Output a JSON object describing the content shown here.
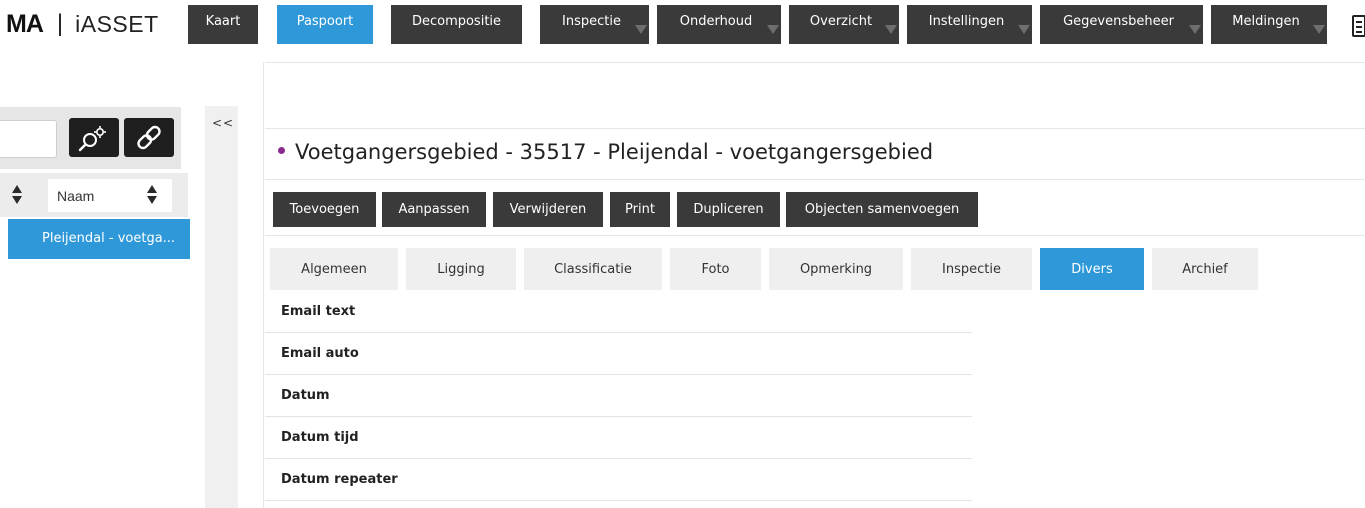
{
  "header": {
    "logo_mark": "MA",
    "logo_separator": "|",
    "app_name": "iASSET",
    "nav": [
      {
        "label": "Kaart",
        "has_dropdown": false,
        "active": false
      },
      {
        "label": "Paspoort",
        "has_dropdown": false,
        "active": true
      },
      {
        "label": "Decompositie",
        "has_dropdown": false,
        "active": false
      },
      {
        "label": "Inspectie",
        "has_dropdown": true,
        "active": false
      },
      {
        "label": "Onderhoud",
        "has_dropdown": true,
        "active": false
      },
      {
        "label": "Overzicht",
        "has_dropdown": true,
        "active": false
      },
      {
        "label": "Instellingen",
        "has_dropdown": true,
        "active": false
      },
      {
        "label": "Gegevensbeheer",
        "has_dropdown": true,
        "active": false
      },
      {
        "label": "Meldingen",
        "has_dropdown": true,
        "active": false
      }
    ],
    "right_icon": "document-icon"
  },
  "sidebar": {
    "search": {
      "value": "",
      "placeholder": ""
    },
    "icons": [
      "search-settings-icon",
      "link-icon"
    ],
    "sort_field": "Naam",
    "selected_item": "Pleijendal - voetga..."
  },
  "collapse_label": "<<",
  "main": {
    "title": "Voetgangersgebied - 35517 - Pleijendal - voetgangersgebied",
    "actions": [
      "Toevoegen",
      "Aanpassen",
      "Verwijderen",
      "Print",
      "Dupliceren",
      "Objecten samenvoegen"
    ],
    "tabs": [
      {
        "label": "Algemeen",
        "active": false
      },
      {
        "label": "Ligging",
        "active": false
      },
      {
        "label": "Classificatie",
        "active": false
      },
      {
        "label": "Foto",
        "active": false
      },
      {
        "label": "Opmerking",
        "active": false
      },
      {
        "label": "Inspectie",
        "active": false
      },
      {
        "label": "Divers",
        "active": true
      },
      {
        "label": "Archief",
        "active": false
      }
    ],
    "fields": [
      "Email text",
      "Email auto",
      "Datum",
      "Datum tijd",
      "Datum repeater"
    ]
  },
  "colors": {
    "accent": "#2e98d9",
    "button_dark": "#3a3a3a",
    "title_dot": "#8a2a8c"
  }
}
